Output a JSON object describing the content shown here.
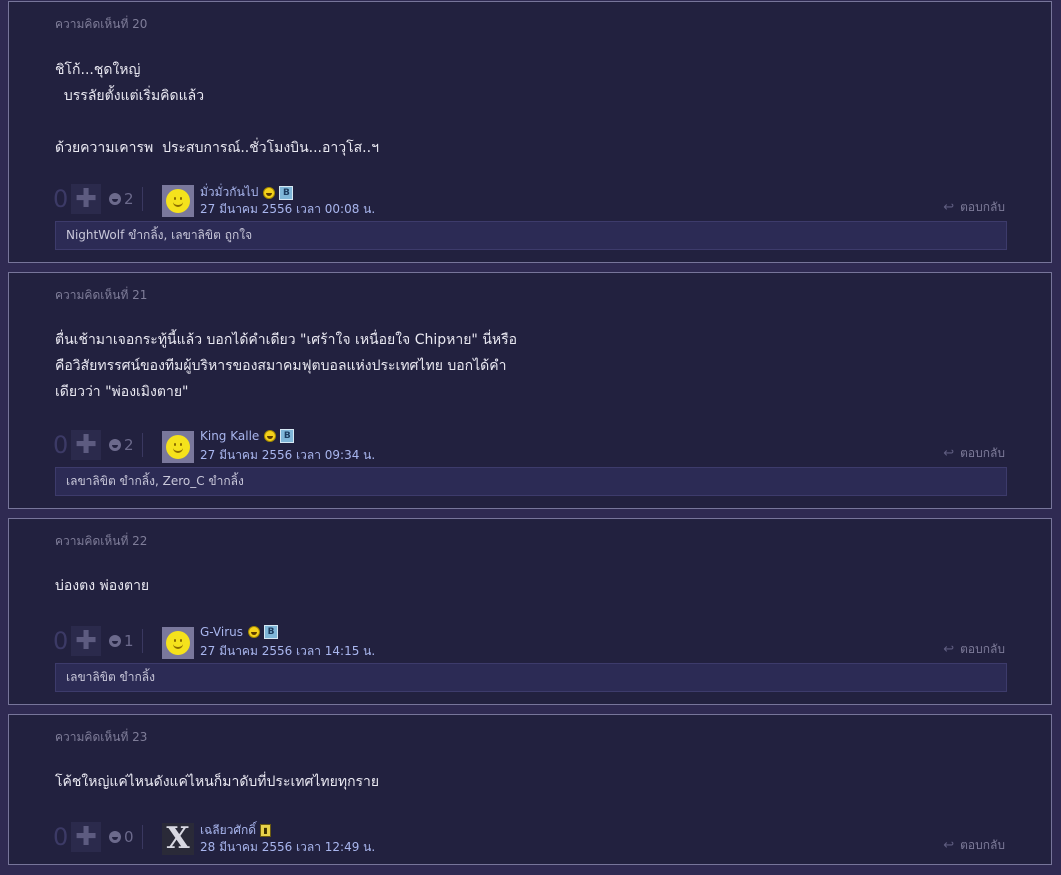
{
  "comments": [
    {
      "title": "ความคิดเห็นที่ 20",
      "body": "ชิโก้...ชุดใหญ่\n  บรรลัยตั้งแต่เริ่มคิดแล้ว\n\nด้วยความเคารพ  ประสบการณ์..ชั่วโมงบิน...อาวุโส..ฯ",
      "score": "0",
      "plus": "✚",
      "emotion_count": "2",
      "author": "มั่วมั่วกันไป",
      "date": "27 มีนาคม 2556 เวลา 00:08 น.",
      "reply_label": "ตอบกลับ",
      "likes": "NightWolf ขำกลิ้ง, เลขาลิขิต ถูกใจ",
      "badge": "B"
    },
    {
      "title": "ความคิดเห็นที่ 21",
      "body": "ตื่นเช้ามาเจอกระทู้นี้แล้ว บอกได้คำเดียว \"เศร้าใจ เหนื่อยใจ Chipหาย\" นี่หรือ\nคือวิสัยทรรศน์ของทีมผู้บริหารของสมาคมฟุตบอลแห่งประเทศไทย บอกได้คำ\nเดียวว่า \"พ่องเมิงตาย\"",
      "score": "0",
      "plus": "✚",
      "emotion_count": "2",
      "author": "King Kalle",
      "date": "27 มีนาคม 2556 เวลา 09:34 น.",
      "reply_label": "ตอบกลับ",
      "likes": "เลขาลิขิต ขำกลิ้ง, Zero_C ขำกลิ้ง",
      "badge": "B"
    },
    {
      "title": "ความคิดเห็นที่ 22",
      "body": "บ่องตง พ่องตาย",
      "score": "0",
      "plus": "✚",
      "emotion_count": "1",
      "author": "G-Virus",
      "date": "27 มีนาคม 2556 เวลา 14:15 น.",
      "reply_label": "ตอบกลับ",
      "likes": "เลขาลิขิต ขำกลิ้ง",
      "badge": "B"
    },
    {
      "title": "ความคิดเห็นที่ 23",
      "body": "โค้ชใหญ่แค่ไหนดังแค่ไหนก็มาดับที่ประเทศไทยทุกราย",
      "score": "0",
      "plus": "✚",
      "emotion_count": "0",
      "author": "เฉลียวศักดิ์",
      "date": "28 มีนาคม 2556 เวลา 12:49 น.",
      "reply_label": "ตอบกลับ",
      "avatar_glyph": "X",
      "badge_y": "▮"
    }
  ],
  "icons": {
    "reply": "↩"
  },
  "colors": {
    "background": "#2f2a52",
    "card": "#22213f",
    "link": "#a9b6ee",
    "avatar_smiley": "#f5e21c"
  }
}
